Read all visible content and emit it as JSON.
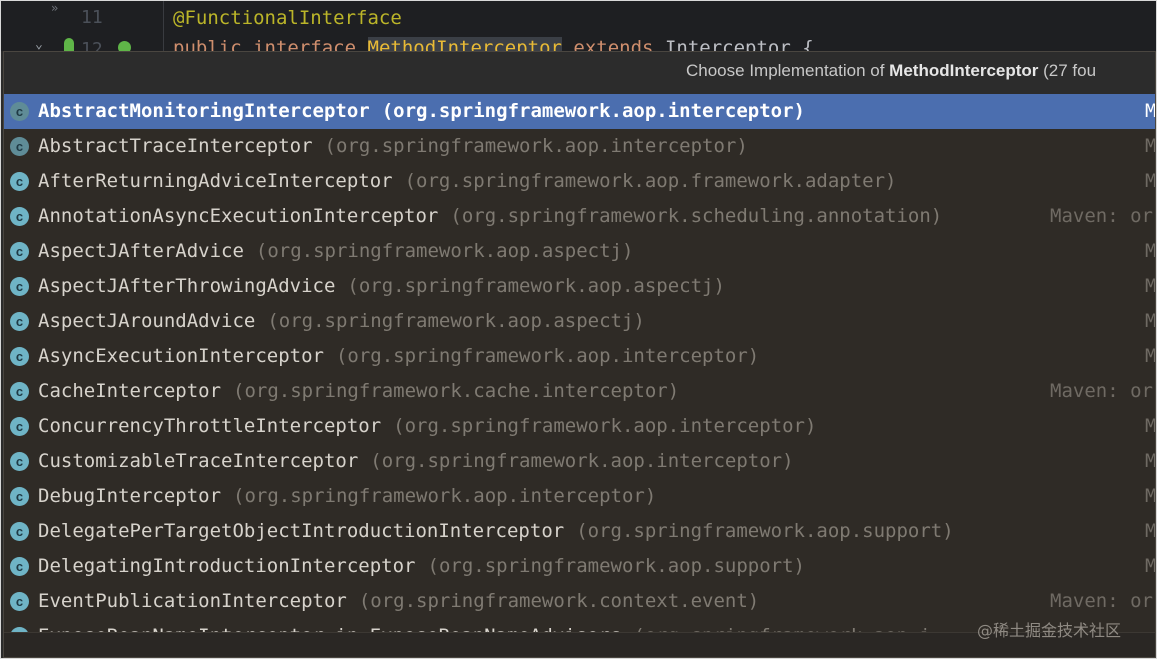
{
  "editor": {
    "line_11": "11",
    "line_12": "12",
    "gutter_chevron": "»",
    "annotation": "@FunctionalInterface",
    "decl_public": "public",
    "decl_interface": "interface",
    "decl_name": "MethodInterceptor",
    "decl_extends": "extends",
    "decl_rest": "Interceptor {"
  },
  "popup": {
    "title_prefix": "Choose Implementation of ",
    "title_name": "MethodInterceptor",
    "title_suffix": " (27 fou"
  },
  "items": [
    {
      "name": "AbstractMonitoringInterceptor",
      "package": "(org.springframework.aop.interceptor)",
      "loc": "M",
      "selected": true,
      "abstract": true
    },
    {
      "name": "AbstractTraceInterceptor",
      "package": "(org.springframework.aop.interceptor)",
      "loc": "M",
      "abstract": true
    },
    {
      "name": "AfterReturningAdviceInterceptor",
      "package": "(org.springframework.aop.framework.adapter)",
      "loc": "M"
    },
    {
      "name": "AnnotationAsyncExecutionInterceptor",
      "package": "(org.springframework.scheduling.annotation)",
      "loc": "Maven: or"
    },
    {
      "name": "AspectJAfterAdvice",
      "package": "(org.springframework.aop.aspectj)",
      "loc": "M"
    },
    {
      "name": "AspectJAfterThrowingAdvice",
      "package": "(org.springframework.aop.aspectj)",
      "loc": "M"
    },
    {
      "name": "AspectJAroundAdvice",
      "package": "(org.springframework.aop.aspectj)",
      "loc": "M"
    },
    {
      "name": "AsyncExecutionInterceptor",
      "package": "(org.springframework.aop.interceptor)",
      "loc": "M"
    },
    {
      "name": "CacheInterceptor",
      "package": "(org.springframework.cache.interceptor)",
      "loc": "Maven: or"
    },
    {
      "name": "ConcurrencyThrottleInterceptor",
      "package": "(org.springframework.aop.interceptor)",
      "loc": "M"
    },
    {
      "name": "CustomizableTraceInterceptor",
      "package": "(org.springframework.aop.interceptor)",
      "loc": "M"
    },
    {
      "name": "DebugInterceptor",
      "package": "(org.springframework.aop.interceptor)",
      "loc": "M"
    },
    {
      "name": "DelegatePerTargetObjectIntroductionInterceptor",
      "package": "(org.springframework.aop.support)",
      "loc": "M"
    },
    {
      "name": "DelegatingIntroductionInterceptor",
      "package": "(org.springframework.aop.support)",
      "loc": "M"
    },
    {
      "name": "EventPublicationInterceptor",
      "package": "(org.springframework.context.event)",
      "loc": "Maven: or"
    },
    {
      "name": "ExposeBeanNameInterceptor in ExposeBeanNameAdvisors",
      "package": "(org.springframework.aop.i",
      "loc": ""
    }
  ],
  "watermark": "@稀土掘金技术社区",
  "colors": {
    "selection": "#4b6eaf",
    "class_icon": "#6fb4c6",
    "popup_bg": "#2f2b26"
  }
}
